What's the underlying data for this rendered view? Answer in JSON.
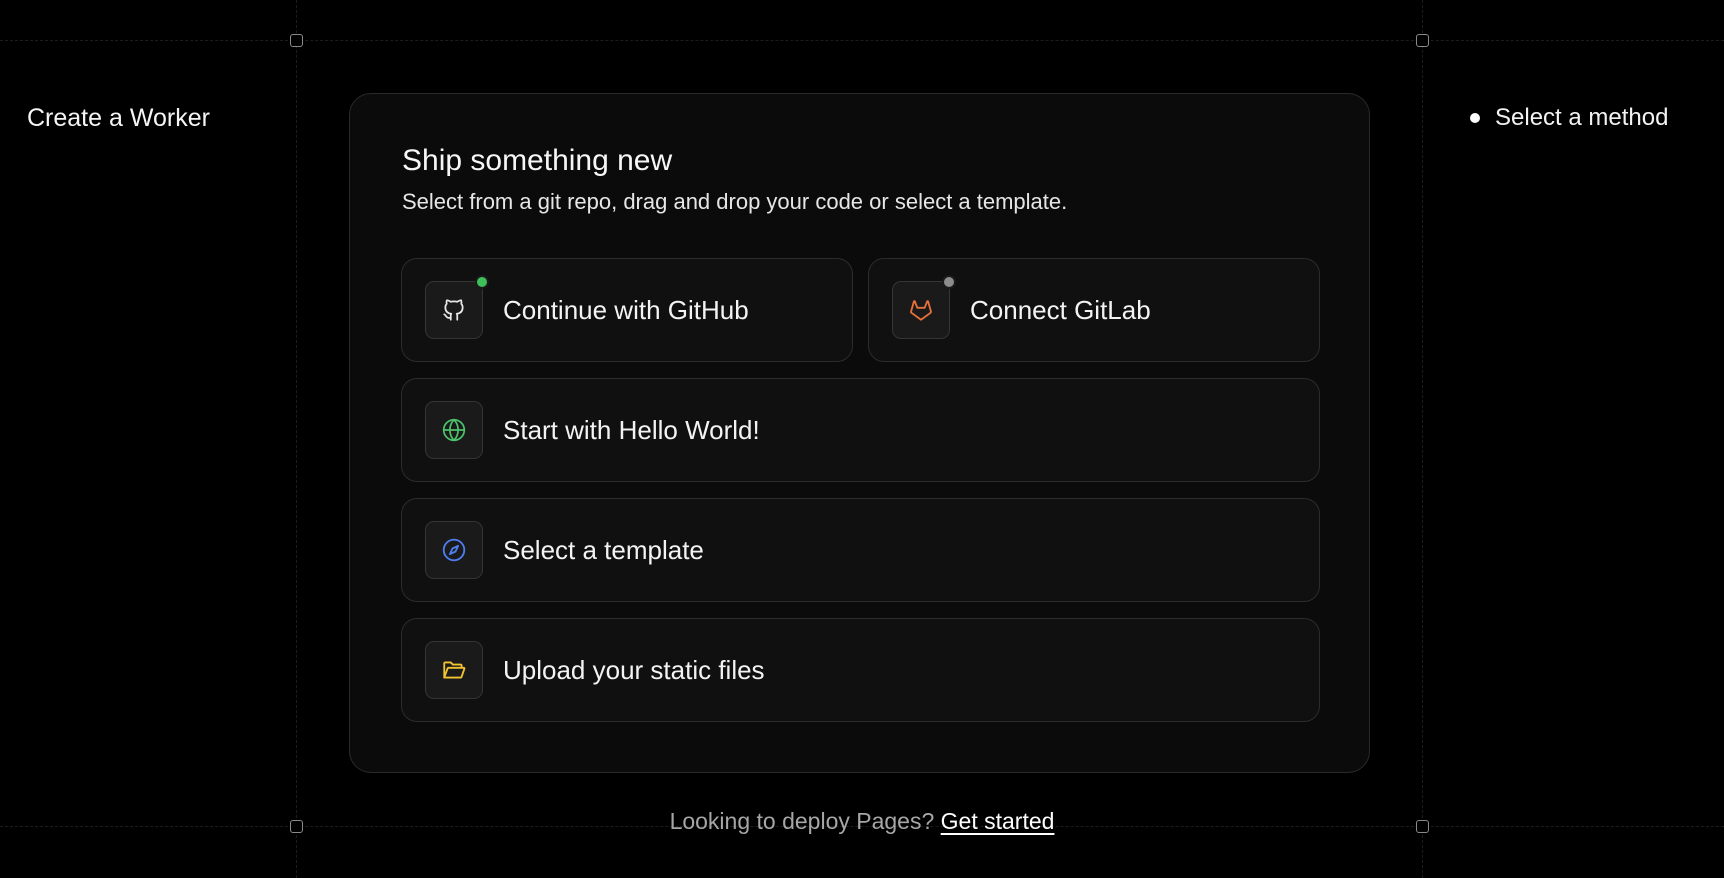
{
  "page": {
    "title": "Create a Worker"
  },
  "steps": [
    {
      "label": "Select a method"
    }
  ],
  "card": {
    "title": "Ship something new",
    "subtitle": "Select from a git repo, drag and drop your code or select a template."
  },
  "options": [
    {
      "label": "Continue with GitHub",
      "icon": "github-icon",
      "status_color": "#3fbf5a"
    },
    {
      "label": "Connect GitLab",
      "icon": "gitlab-icon",
      "status_color": "#8c8c8c"
    },
    {
      "label": "Start with Hello World!",
      "icon": "globe-icon",
      "icon_color": "#4cc26a"
    },
    {
      "label": "Select a template",
      "icon": "compass-icon",
      "icon_color": "#4f7df0"
    },
    {
      "label": "Upload your static files",
      "icon": "folder-open-icon",
      "icon_color": "#f1c232"
    }
  ],
  "footer": {
    "text": "Looking to deploy Pages?",
    "link": "Get started"
  },
  "colors": {
    "background": "#000000",
    "card": "#0b0b0b",
    "option": "#101010",
    "gitlab": "#e8703a"
  }
}
